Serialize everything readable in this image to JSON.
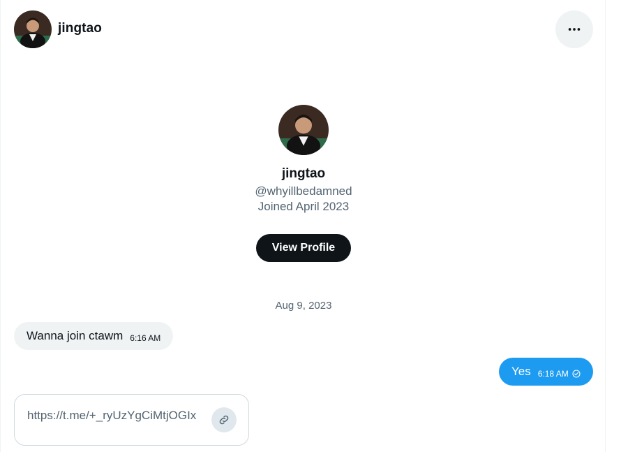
{
  "header": {
    "name": "jingtao",
    "more_icon": "more-horizontal-icon"
  },
  "profile": {
    "name": "jingtao",
    "handle": "@whyillbedamned",
    "joined": "Joined April 2023",
    "view_profile_label": "View Profile"
  },
  "conversation": {
    "date_divider": "Aug 9, 2023",
    "messages": [
      {
        "direction": "incoming",
        "text": "Wanna join ctawm",
        "time": "6:16 AM"
      },
      {
        "direction": "outgoing",
        "text": "Yes",
        "time": "6:18 AM",
        "status_icon": "seen-check-icon"
      }
    ],
    "link_preview": {
      "url": "https://t.me/+_ryUzYgCiMtjOGIx",
      "icon": "link-icon"
    }
  },
  "colors": {
    "accent": "#1d9bf0",
    "button_dark": "#0f1419",
    "muted_text": "#536471",
    "bubble_incoming": "#eff3f4"
  }
}
